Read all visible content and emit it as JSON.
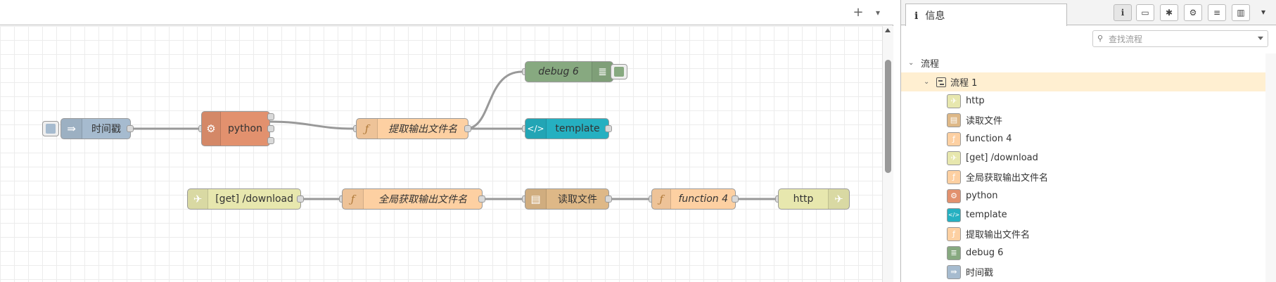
{
  "workspace": {
    "add_tab_icon": "+",
    "tab_menu_icon": "▾"
  },
  "nodes": {
    "timestamp": {
      "label": "时间戳",
      "color": "#a6bbcf"
    },
    "python": {
      "label": "python",
      "color": "#e2916e"
    },
    "extract": {
      "label": "提取输出文件名",
      "color": "#fdd0a2"
    },
    "debug": {
      "label": "debug 6",
      "color": "#87a980"
    },
    "template": {
      "label": "template",
      "color": "#25b0c1"
    },
    "get_download": {
      "label": "[get] /download",
      "color": "#e7e7ae"
    },
    "global_get": {
      "label": "全局获取输出文件名",
      "color": "#fdd0a2"
    },
    "read_file": {
      "label": "读取文件",
      "color": "#deb887"
    },
    "function4": {
      "label": "function 4",
      "color": "#fdd0a2"
    },
    "http": {
      "label": "http",
      "color": "#e7e7ae"
    }
  },
  "sidebar": {
    "tab_label": "信息",
    "search_placeholder": "查找流程",
    "tree": {
      "root_label": "流程",
      "flow_label": "流程 1",
      "items": [
        {
          "label": "http",
          "icon": "http-icon",
          "color": "#e7e7ae"
        },
        {
          "label": "读取文件",
          "icon": "file-icon",
          "color": "#deb887"
        },
        {
          "label": "function 4",
          "icon": "function-icon",
          "color": "#fdd0a2"
        },
        {
          "label": "[get] /download",
          "icon": "http-icon",
          "color": "#e7e7ae"
        },
        {
          "label": "全局获取输出文件名",
          "icon": "function-icon",
          "color": "#fdd0a2"
        },
        {
          "label": "python",
          "icon": "gear-icon",
          "color": "#e2916e"
        },
        {
          "label": "template",
          "icon": "template-icon",
          "color": "#25b0c1"
        },
        {
          "label": "提取输出文件名",
          "icon": "function-icon",
          "color": "#fdd0a2"
        },
        {
          "label": "debug 6",
          "icon": "debug-icon",
          "color": "#87a980"
        },
        {
          "label": "时间戳",
          "icon": "inject-icon",
          "color": "#a6bbcf"
        }
      ]
    }
  }
}
